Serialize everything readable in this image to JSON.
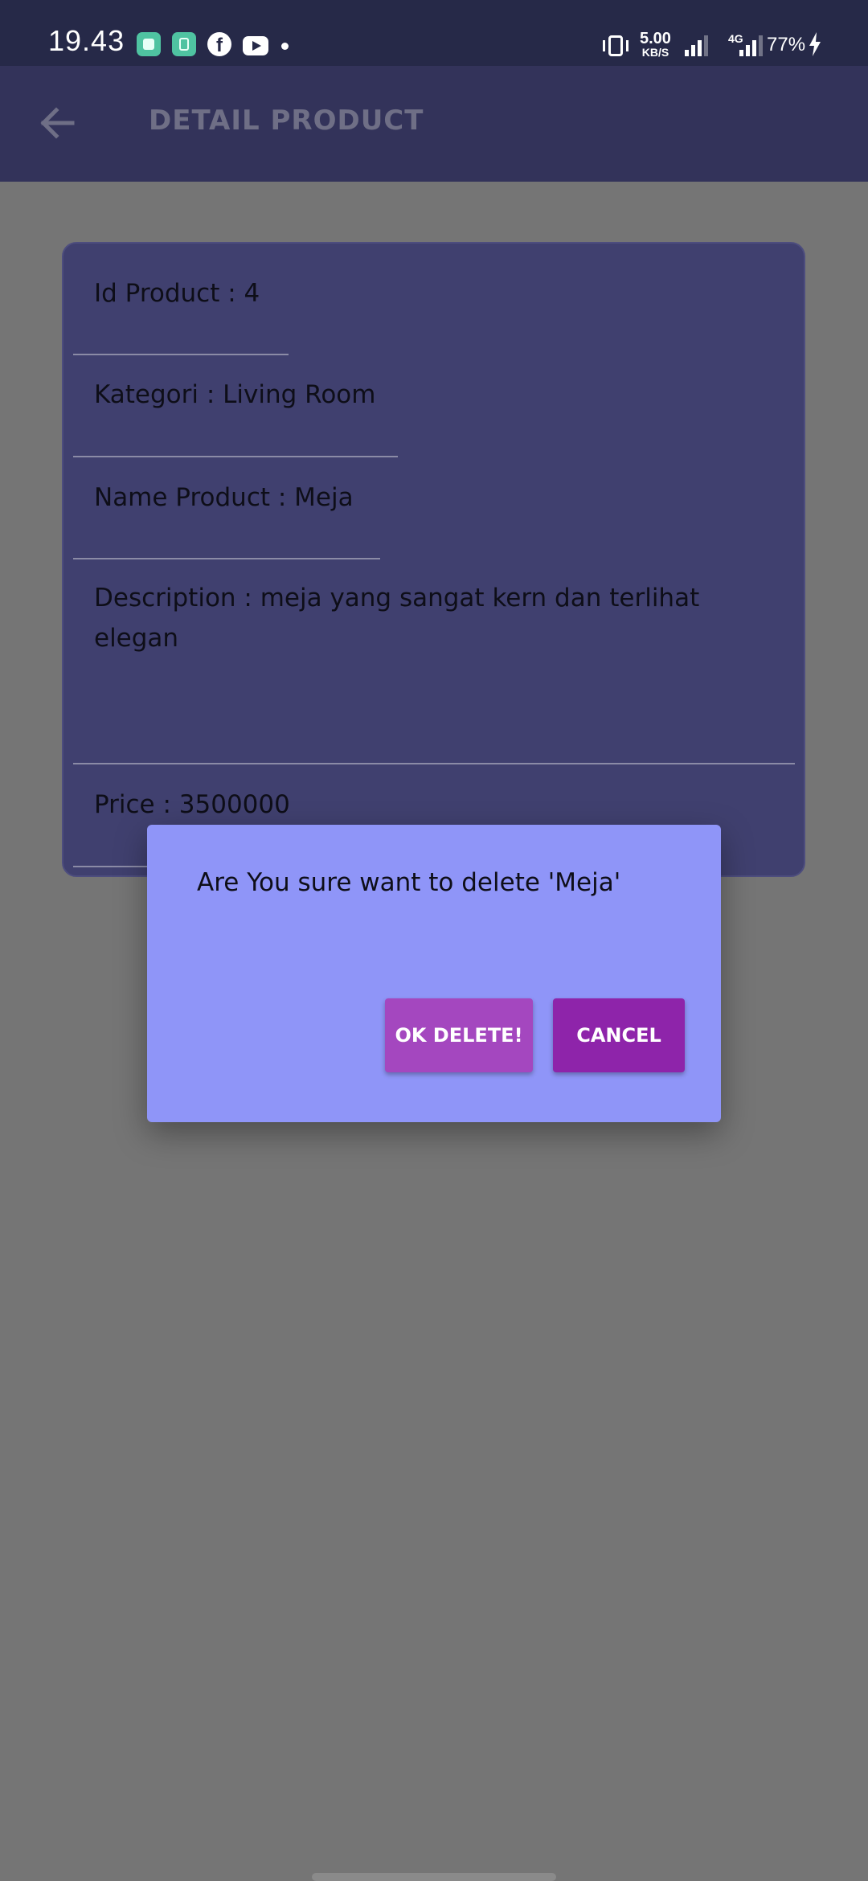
{
  "status_bar": {
    "time": "19.43",
    "speed_value": "5.00",
    "speed_unit": "KB/S",
    "network": "4G",
    "battery": "77%",
    "icons": [
      "app-icon",
      "app-icon",
      "facebook-icon",
      "youtube-icon",
      "dot-icon",
      "vibrate-icon",
      "signal-icon",
      "signal-icon",
      "charging-icon"
    ]
  },
  "app_bar": {
    "title": "DETAIL PRODUCT",
    "back_icon": "arrow-left-icon"
  },
  "product": {
    "id_label": "Id Product : 4",
    "category_label": "Kategori : Living Room",
    "name_label": "Name Product : Meja",
    "description_label": "Description : meja yang sangat kern dan terlihat elegan",
    "price_label": "Price : 3500000"
  },
  "dialog": {
    "message": "Are You sure want to delete 'Meja'",
    "ok_label": "OK DELETE!",
    "cancel_label": "CANCEL"
  },
  "colors": {
    "status_bar": "#262948",
    "app_bar": "#33335a",
    "card": "#40406f",
    "dialog": "#8f95f8",
    "ok_button": "#a447bf",
    "cancel_button": "#8e24aa",
    "scrim": "#757575"
  }
}
